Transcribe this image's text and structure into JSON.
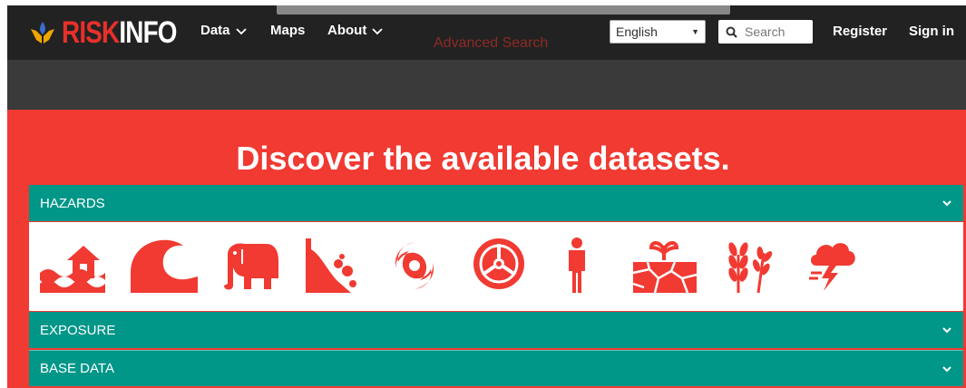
{
  "navbar": {
    "brand": {
      "risk": "RISK",
      "info": "INFO"
    },
    "items": [
      {
        "label": "Data",
        "has_dropdown": true
      },
      {
        "label": "Maps",
        "has_dropdown": false
      },
      {
        "label": "About",
        "has_dropdown": true
      }
    ],
    "advanced_search": "Advanced Search",
    "language": {
      "selected": "English"
    },
    "search": {
      "placeholder": "Search"
    },
    "register": "Register",
    "sign_in": "Sign in"
  },
  "hero": {
    "title": "Discover the available datasets."
  },
  "categories": [
    {
      "label": "HAZARDS",
      "expanded": true
    },
    {
      "label": "EXPOSURE",
      "expanded": false
    },
    {
      "label": "BASE DATA",
      "expanded": false
    }
  ],
  "hazard_icons": [
    "flood-icon",
    "tsunami-icon",
    "elephant-icon",
    "landslide-icon",
    "cyclone-icon",
    "biohazard-icon",
    "person-icon",
    "drought-icon",
    "wheat-icon",
    "storm-icon"
  ],
  "colors": {
    "brand_red": "#f03a32",
    "teal": "#009688",
    "navbar": "#222222",
    "subbar": "#3a3a3a"
  }
}
